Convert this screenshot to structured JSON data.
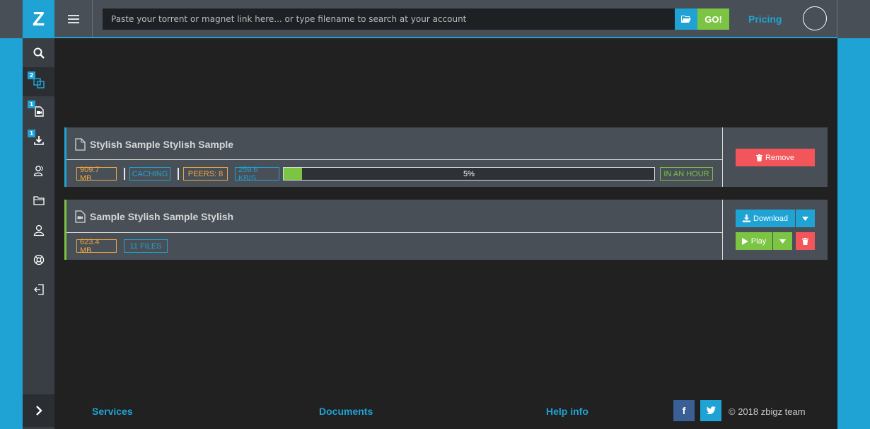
{
  "app": {
    "logo": "Z"
  },
  "header": {
    "search_placeholder": "Paste your torrent or magnet link here... or type filename to search at your account",
    "go_label": "GO!",
    "pricing_label": "Pricing"
  },
  "sidebar": {
    "items": [
      {
        "icon": "search-icon",
        "badge": ""
      },
      {
        "icon": "copy-icon",
        "badge": "2"
      },
      {
        "icon": "video-file-icon",
        "badge": "1"
      },
      {
        "icon": "download-tray-icon",
        "badge": "1"
      },
      {
        "icon": "user-group-icon",
        "badge": ""
      },
      {
        "icon": "folder-icon",
        "badge": ""
      },
      {
        "icon": "user-icon",
        "badge": ""
      },
      {
        "icon": "lifebuoy-icon",
        "badge": ""
      },
      {
        "icon": "logout-icon",
        "badge": ""
      }
    ]
  },
  "torrents": [
    {
      "title": "Stylish Sample Stylish Sample",
      "size": "909.7 MB",
      "status": "CACHING",
      "peers": "PEERS: 8",
      "speed": "259.6 KB/S",
      "progress_percent": 5,
      "progress_label": "5%",
      "eta": "IN AN HOUR",
      "remove_label": "Remove"
    },
    {
      "title": "Sample Stylish Sample Stylish",
      "size": "623.4 MB",
      "files": "11 FILES",
      "download_label": "Download",
      "play_label": "Play"
    }
  ],
  "footer": {
    "services": "Services",
    "documents": "Documents",
    "help": "Help info",
    "facebook": "f",
    "copyright": "© 2018 zbigz team"
  },
  "colors": {
    "accent": "#1fa3d4",
    "success": "#7cc443",
    "danger": "#f2565a",
    "warning": "#f0a840"
  }
}
